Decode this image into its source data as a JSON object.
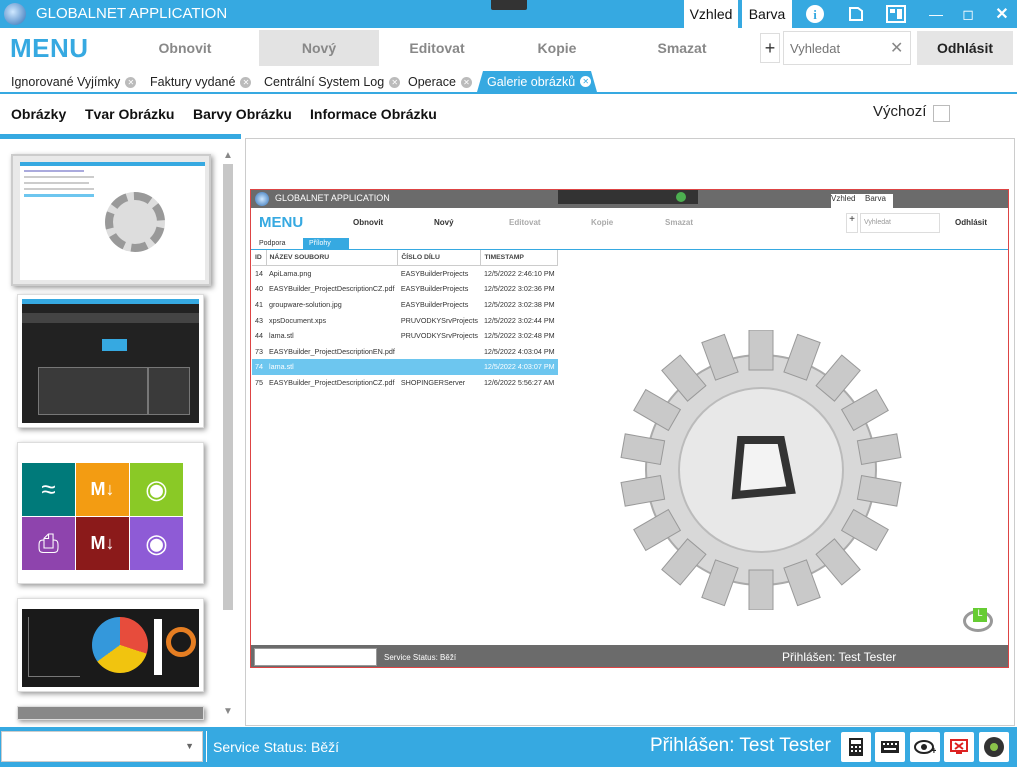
{
  "app": {
    "title": "GLOBALNET APPLICATION",
    "vzhled": "Vzhled",
    "barva": "Barva"
  },
  "menu": {
    "logo": "MENU",
    "items": [
      "Obnovit",
      "Nový",
      "Editovat",
      "Kopie",
      "Smazat"
    ],
    "active_index": 1,
    "plus": "+",
    "search_placeholder": "Vyhledat",
    "logout": "Odhlásit"
  },
  "tabs": [
    {
      "label": "Ignorované Vyjímky"
    },
    {
      "label": "Faktury vydané"
    },
    {
      "label": "Centrální System Log"
    },
    {
      "label": "Operace"
    }
  ],
  "active_tab": "Galerie obrázků",
  "subnav": [
    "Obrázky",
    "Tvar Obrázku",
    "Barvy Obrázku",
    "Informace Obrázku"
  ],
  "default_label": "Výchozí",
  "status": {
    "service": "Service Status:",
    "service_value": "Běží",
    "user": "Přihlášen: Test Tester"
  },
  "inner": {
    "title": "GLOBALNET APPLICATION",
    "vzhled": "Vzhled",
    "barva": "Barva",
    "menu_logo": "MENU",
    "menu_items": [
      "Obnovit",
      "Nový",
      "Editovat",
      "Kopie",
      "Smazat"
    ],
    "search_placeholder": "Vyhledat",
    "logout": "Odhlásit",
    "plus": "+",
    "tabs": [
      "Podpora",
      "Přílohy"
    ],
    "columns": [
      "ID",
      "NÁZEV SOUBORU",
      "ČÍSLO DÍLU",
      "TIMESTAMP"
    ],
    "rows": [
      [
        "14",
        "ApiLama.png",
        "EASYBuilderProjects",
        "12/5/2022 2:46:10 PM"
      ],
      [
        "40",
        "EASYBuilder_ProjectDescriptionCZ.pdf",
        "EASYBuilderProjects",
        "12/5/2022 3:02:36 PM"
      ],
      [
        "41",
        "groupware-solution.jpg",
        "EASYBuilderProjects",
        "12/5/2022 3:02:38 PM"
      ],
      [
        "43",
        "xpsDocument.xps",
        "PRUVODKYSrvProjects",
        "12/5/2022 3:02:44 PM"
      ],
      [
        "44",
        "lama.stl",
        "PRUVODKYSrvProjects",
        "12/5/2022 3:02:48 PM"
      ],
      [
        "73",
        "EASYBuilder_ProjectDescriptionEN.pdf",
        "",
        "12/5/2022 4:03:04 PM"
      ],
      [
        "74",
        "lama.stl",
        "",
        "12/5/2022 4:03:07 PM"
      ],
      [
        "75",
        "EASYBuilder_ProjectDescriptionCZ.pdf",
        "SHOPINGERServer",
        "12/6/2022 5:56:27 AM"
      ]
    ],
    "selected_row": 6,
    "status_service": "Service Status:",
    "status_value": "Běží",
    "status_user": "Přihlášen: Test Tester"
  },
  "colors": {
    "accent": "#36a9e1",
    "selected_row": "#6dc6ef"
  }
}
